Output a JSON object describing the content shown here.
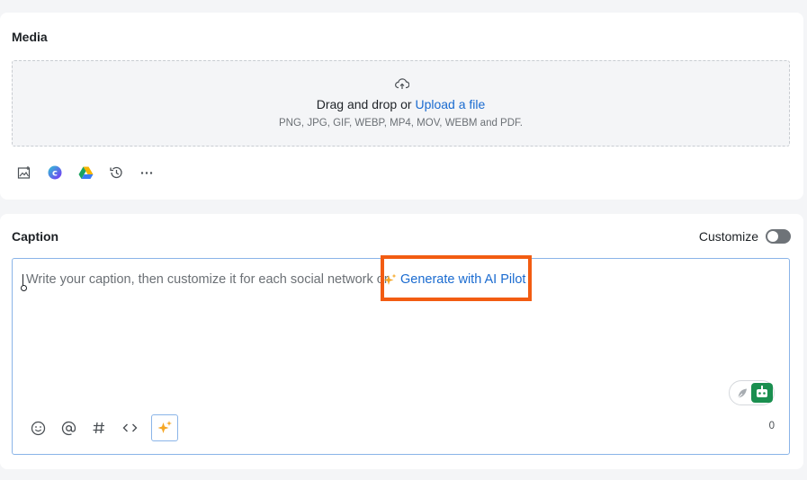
{
  "media": {
    "title": "Media",
    "dropzone": {
      "prefix": "Drag and drop or ",
      "link": "Upload a file",
      "formats": "PNG, JPG, GIF, WEBP, MP4, MOV, WEBM and PDF."
    },
    "tools": [
      "add-image-icon",
      "canva-icon",
      "google-drive-icon",
      "history-icon",
      "more-icon"
    ]
  },
  "caption": {
    "title": "Caption",
    "customize_label": "Customize",
    "customize_enabled": false,
    "placeholder": "Write your caption, then customize it for each social network or",
    "ai_link": "Generate with AI Pilot",
    "char_count": "0",
    "tools": [
      "emoji-icon",
      "mention-icon",
      "hashtag-icon",
      "code-icon",
      "ai-sparkle-icon"
    ]
  },
  "colors": {
    "link": "#1a6bd0",
    "highlight": "#f25c12",
    "sparkle": "#f5a623",
    "bot": "#1a8f4f"
  }
}
